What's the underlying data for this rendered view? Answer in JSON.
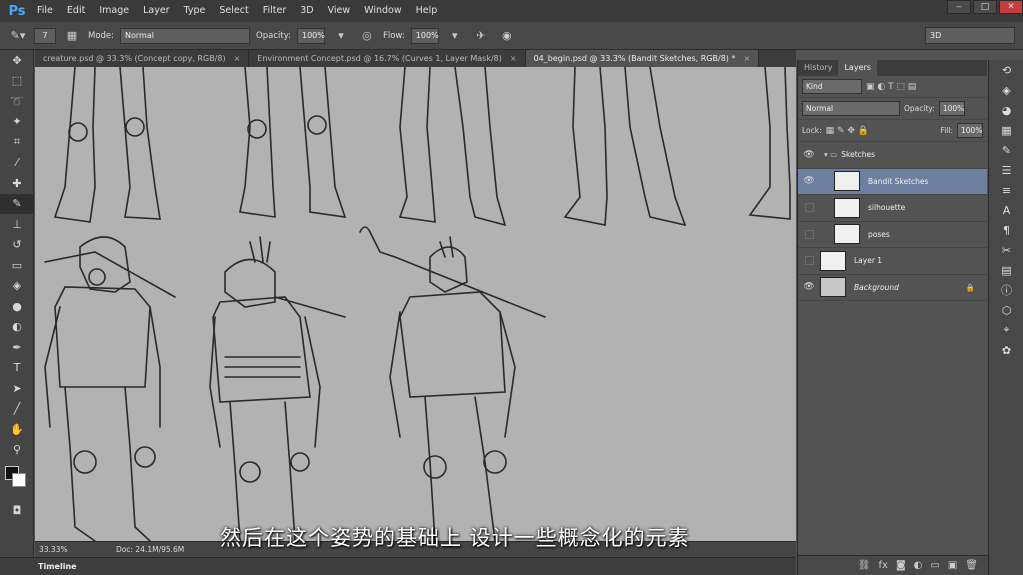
{
  "app": {
    "logo": "Ps"
  },
  "menu": [
    "File",
    "Edit",
    "Image",
    "Layer",
    "Type",
    "Select",
    "Filter",
    "3D",
    "View",
    "Window",
    "Help"
  ],
  "options": {
    "brush_size": "7",
    "mode_label": "Mode:",
    "mode_value": "Normal",
    "opacity_label": "Opacity:",
    "opacity_value": "100%",
    "flow_label": "Flow:",
    "flow_value": "100%",
    "workspace": "3D"
  },
  "tabs": [
    {
      "label": "creature.psd @ 33.3% (Concept copy, RGB/8)",
      "close": "×"
    },
    {
      "label": "Environment Concept.psd @ 16.7% (Curves 1, Layer Mask/8)",
      "close": "×"
    },
    {
      "label": "04_begin.psd @ 33.3% (Bandit Sketches, RGB/8) *",
      "close": "×"
    }
  ],
  "status": {
    "zoom": "33.33%",
    "doc": "Doc: 24.1M/95.6M"
  },
  "timeline_label": "Timeline",
  "subtitle": "然后在这个姿势的基础上 设计一些概念化的元素",
  "panel": {
    "tabs": [
      "History",
      "Layers"
    ],
    "filter_kind": "Kind",
    "blend_mode": "Normal",
    "opacity_label": "Opacity:",
    "opacity_value": "100%",
    "lock_label": "Lock:",
    "fill_label": "Fill:",
    "fill_value": "100%",
    "layers": [
      {
        "name": "Sketches",
        "type": "group",
        "visible": true
      },
      {
        "name": "Bandit Sketches",
        "selected": true,
        "visible": true
      },
      {
        "name": "silhouette",
        "visible": false
      },
      {
        "name": "poses",
        "visible": false
      },
      {
        "name": "Layer 1",
        "visible": false
      },
      {
        "name": "Background",
        "visible": true,
        "locked": true
      }
    ]
  },
  "colors": {
    "foreground": "#111111",
    "background": "#ffffff",
    "selection": "#6e7fa0"
  }
}
